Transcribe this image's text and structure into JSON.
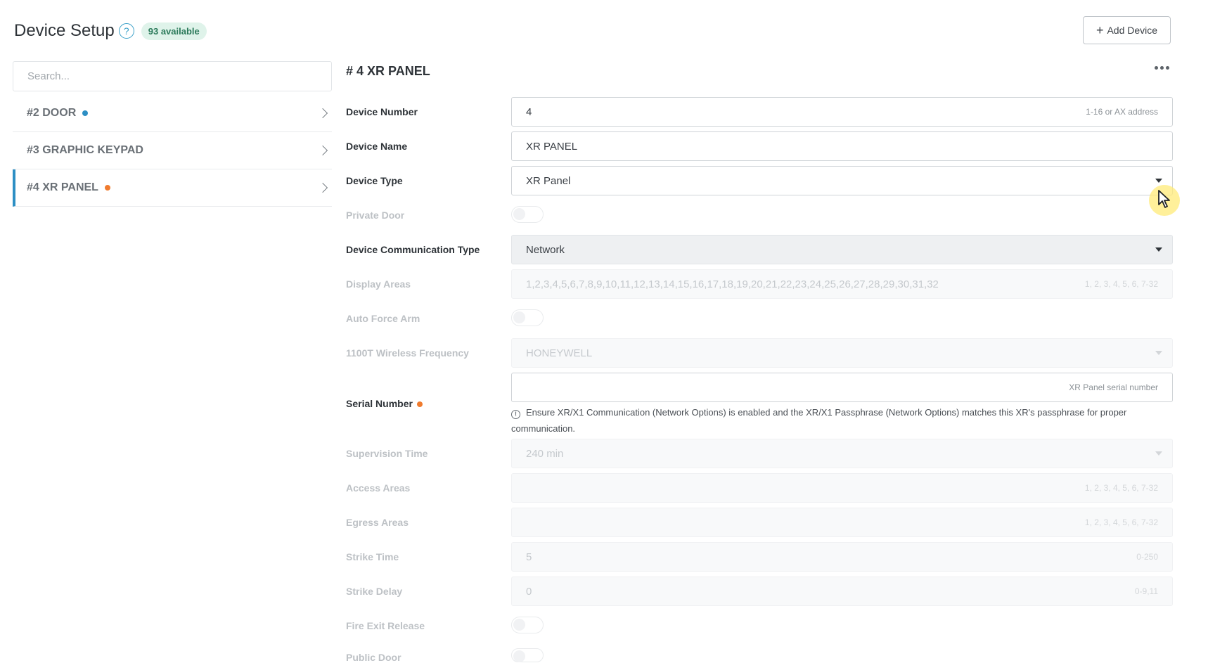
{
  "header": {
    "title": "Device Setup",
    "help_icon": "question-circle-icon",
    "help_glyph": "?",
    "available_badge": "93 available",
    "add_button_plus": "+",
    "add_button_label": "Add Device"
  },
  "search": {
    "placeholder": "Search..."
  },
  "devices": [
    {
      "label": "#2 DOOR",
      "status": "blue",
      "active": false
    },
    {
      "label": "#3 GRAPHIC KEYPAD",
      "status": "none",
      "active": false
    },
    {
      "label": "#4 XR PANEL",
      "status": "orange",
      "active": true
    }
  ],
  "panel": {
    "title": "# 4 XR PANEL",
    "more_icon": "ellipsis-horizontal-icon"
  },
  "form": {
    "device_number": {
      "label": "Device Number",
      "value": "4",
      "hint": "1-16 or AX address"
    },
    "device_name": {
      "label": "Device Name",
      "value": "XR PANEL"
    },
    "device_type": {
      "label": "Device Type",
      "value": "XR Panel"
    },
    "private_door": {
      "label": "Private Door",
      "on": false
    },
    "communication_type": {
      "label": "Device Communication Type",
      "value": "Network"
    },
    "display_areas": {
      "label": "Display Areas",
      "value": "1,2,3,4,5,6,7,8,9,10,11,12,13,14,15,16,17,18,19,20,21,22,23,24,25,26,27,28,29,30,31,32",
      "hint": "1, 2, 3, 4, 5, 6, 7-32"
    },
    "auto_force_arm": {
      "label": "Auto Force Arm",
      "on": false
    },
    "wireless_frequency": {
      "label": "1100T Wireless Frequency",
      "value": "HONEYWELL"
    },
    "serial_number": {
      "label": "Serial Number",
      "value": "",
      "hint": "XR Panel serial number",
      "required": "orange"
    },
    "serial_note": {
      "icon_glyph": "!",
      "text": "Ensure XR/X1 Communication (Network Options) is enabled and the XR/X1 Passphrase (Network Options) matches this XR's passphrase for proper communication."
    },
    "supervision_time": {
      "label": "Supervision Time",
      "value": "240 min"
    },
    "access_areas": {
      "label": "Access Areas",
      "value": "",
      "hint": "1, 2, 3, 4, 5, 6, 7-32"
    },
    "egress_areas": {
      "label": "Egress Areas",
      "value": "",
      "hint": "1, 2, 3, 4, 5, 6, 7-32"
    },
    "strike_time": {
      "label": "Strike Time",
      "value": "5",
      "hint": "0-250"
    },
    "strike_delay": {
      "label": "Strike Delay",
      "value": "0",
      "hint": "0-9,11"
    },
    "fire_exit_release": {
      "label": "Fire Exit Release",
      "on": false
    },
    "public_door": {
      "label": "Public Door",
      "on": false
    }
  },
  "colors": {
    "accent": "#2d8fc4",
    "status_orange": "#f07b2e",
    "badge_bg": "#dff3ea",
    "badge_text": "#2b7a5a"
  }
}
